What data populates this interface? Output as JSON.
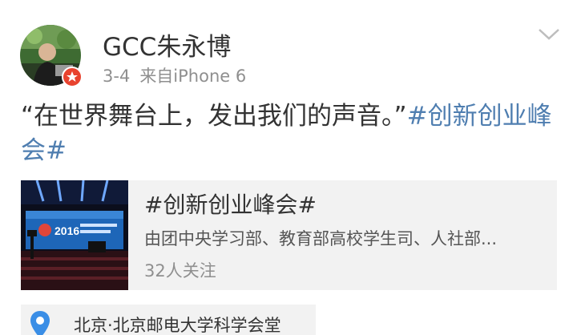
{
  "post": {
    "author": "GCC朱永博",
    "date": "3-4",
    "source": "来自iPhone 6",
    "text_quote": "“在世界舞台上，发出我们的声音。”",
    "hashtag": "#创新创业峰会#"
  },
  "topic_card": {
    "title": "#创新创业峰会#",
    "description": "由团中央学习部、教育部高校学生司、人社部...",
    "followers": "32人关注",
    "thumbnail_text": "2016"
  },
  "location": {
    "text": "北京·北京邮电大学科学会堂"
  },
  "icons": {
    "menu": "chevron-down-icon",
    "location": "location-pin-icon",
    "verified": "verified-badge-icon"
  },
  "colors": {
    "hashtag": "#4f7eb0",
    "card_background": "#f2f2f2",
    "badge": "#e8432f",
    "location_pin": "#3a8ee6"
  }
}
